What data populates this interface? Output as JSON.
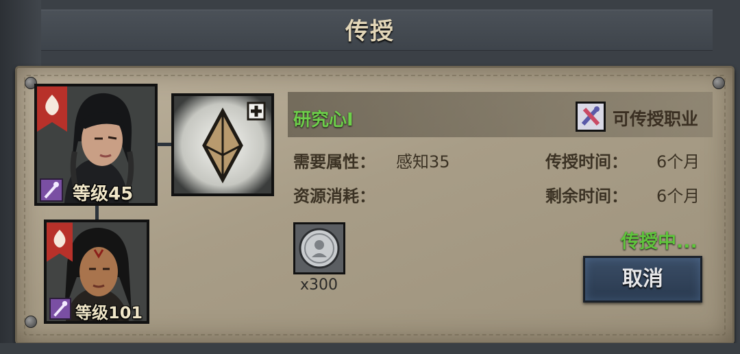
{
  "window": {
    "title": "传授"
  },
  "characters": [
    {
      "level_label": "等级45",
      "class_icon": "staff-icon",
      "element_icon": "fire-icon"
    },
    {
      "level_label": "等级101",
      "class_icon": "staff-icon",
      "element_icon": "fire-icon"
    }
  ],
  "skill": {
    "icon": "crystal-icon",
    "name": "研究心I",
    "job_icon": "crossed-tools-icon",
    "job_label": "可传授职业"
  },
  "requirements": {
    "attr_label": "需要属性：",
    "attr_value": "感知35",
    "resource_label": "资源消耗："
  },
  "timing": {
    "teach_label": "传授时间：",
    "teach_value": "6个月",
    "remain_label": "剩余时间：",
    "remain_value": "6个月"
  },
  "cost": {
    "item_icon": "silver-coin-icon",
    "quantity": "x300"
  },
  "status_text": "传授中...",
  "cancel_label": "取消",
  "colors": {
    "accent_green": "#5fc43c",
    "panel": "#a89d87",
    "button": "#2f4158"
  }
}
